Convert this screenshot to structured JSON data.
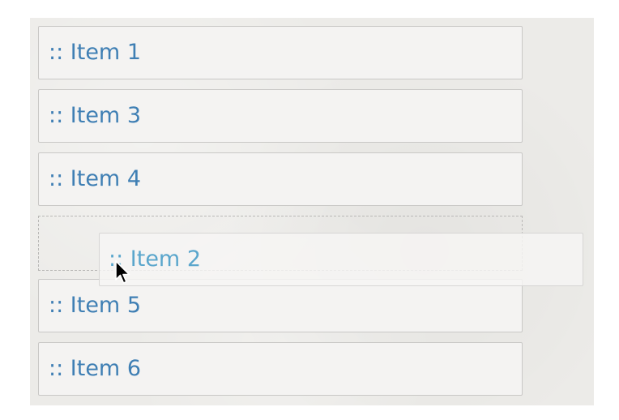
{
  "list": {
    "items": [
      {
        "label": ":: Item 1"
      },
      {
        "label": ":: Item 3"
      },
      {
        "label": ":: Item 4"
      },
      {
        "label": ":: Item 5"
      },
      {
        "label": ":: Item 6"
      }
    ],
    "dragging_item": {
      "label": ":: Item 2"
    }
  },
  "colors": {
    "panel_background": "#ecebe8",
    "item_background": "#f4f3f2",
    "item_border": "#c9c8c6",
    "item_text": "#3f7fb4",
    "dragging_text": "#5aa6cc"
  },
  "icons": {
    "cursor": "arrow-cursor-icon"
  }
}
